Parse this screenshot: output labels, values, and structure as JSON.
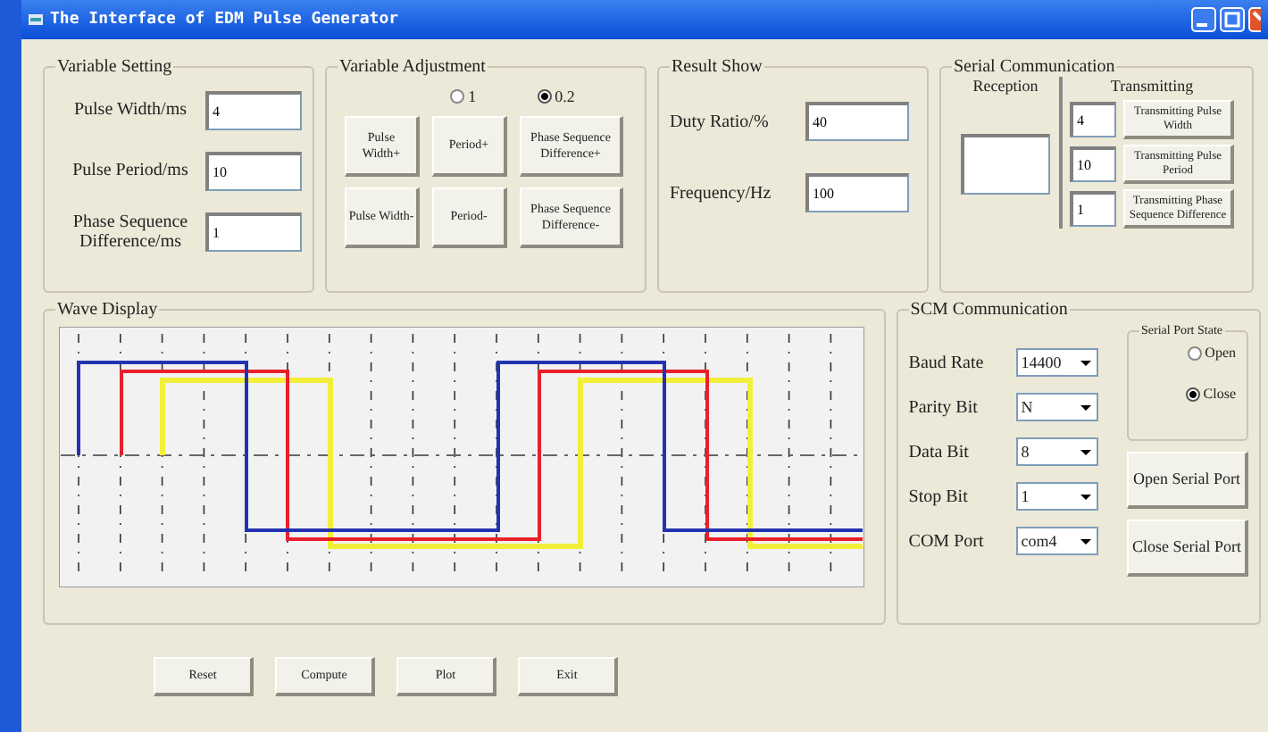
{
  "window": {
    "title": "The Interface of EDM Pulse Generator"
  },
  "variable_setting": {
    "title": "Variable Setting",
    "fields": [
      {
        "label": "Pulse Width/ms",
        "value": "4"
      },
      {
        "label": "Pulse Period/ms",
        "value": "10"
      },
      {
        "label": "Phase Sequence Difference/ms",
        "value": "1"
      }
    ]
  },
  "variable_adjustment": {
    "title": "Variable Adjustment",
    "steps": [
      {
        "label": "1",
        "selected": false
      },
      {
        "label": "0.2",
        "selected": true
      }
    ],
    "buttons": [
      "Pulse Width+",
      "Period+",
      "Phase Sequence Difference+",
      "Pulse Width-",
      "Period-",
      "Phase Sequence Difference-"
    ]
  },
  "result_show": {
    "title": "Result Show",
    "fields": [
      {
        "label": "Duty Ratio/%",
        "value": "40"
      },
      {
        "label": "Frequency/Hz",
        "value": "100"
      }
    ]
  },
  "serial_communication": {
    "title": "Serial Communication",
    "reception_label": "Reception",
    "transmitting_label": "Transmitting",
    "rows": [
      {
        "value": "4",
        "button": "Transmitting Pulse Width"
      },
      {
        "value": "10",
        "button": "Transmitting Pulse Period"
      },
      {
        "value": "1",
        "button": "Transmitting Phase Sequence Difference"
      }
    ]
  },
  "wave_display": {
    "title": "Wave Display"
  },
  "scm_communication": {
    "title": "SCM Communication",
    "settings": [
      {
        "label": "Baud Rate",
        "value": "14400"
      },
      {
        "label": "Parity Bit",
        "value": "N"
      },
      {
        "label": "Data Bit",
        "value": "8"
      },
      {
        "label": "Stop Bit",
        "value": "1"
      },
      {
        "label": "COM Port",
        "value": "com4"
      }
    ],
    "port_state": {
      "title": "Serial Port State",
      "options": [
        {
          "label": "Open",
          "selected": false
        },
        {
          "label": "Close",
          "selected": true
        }
      ]
    },
    "buttons": [
      "Open Serial Port",
      "Close Serial Port"
    ]
  },
  "buttons": [
    "Reset",
    "Compute",
    "Plot",
    "Exit"
  ]
}
